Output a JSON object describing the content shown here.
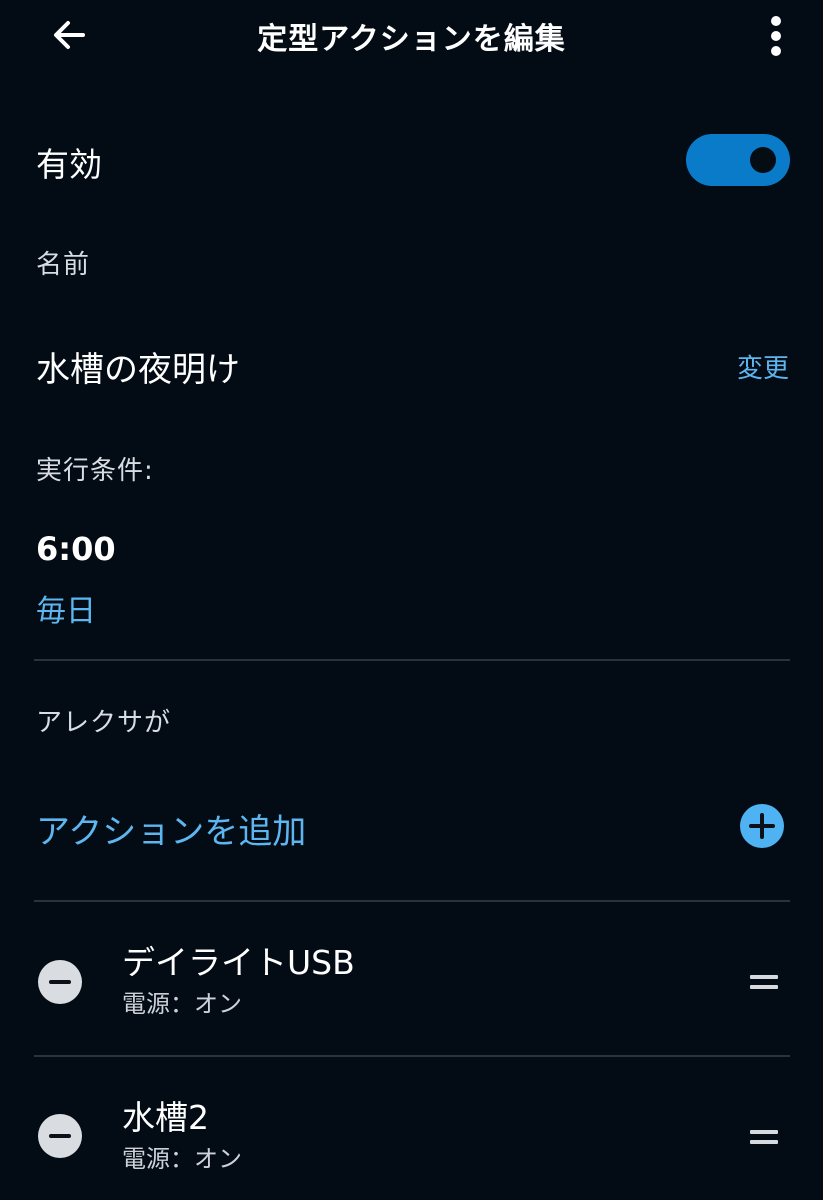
{
  "header": {
    "title": "定型アクションを編集",
    "back_icon": "arrow-left-icon",
    "more_icon": "more-vertical-icon"
  },
  "enabled": {
    "label": "有効",
    "state": "on",
    "accent_color": "#0a7bc9"
  },
  "name_section": {
    "label": "名前",
    "value": "水槽の夜明け",
    "change_label": "変更"
  },
  "trigger_section": {
    "label": "実行条件:",
    "time": "6:00",
    "repeat": "毎日"
  },
  "actions_section": {
    "label": "アレクサが",
    "add_label": "アクションを追加",
    "add_icon": "plus-circle-icon",
    "items": [
      {
        "name": "デイライトUSB",
        "detail": "電源：オン"
      },
      {
        "name": "水槽2",
        "detail": "電源：オン"
      }
    ]
  },
  "colors": {
    "background": "#030b14",
    "link": "#5db6f0",
    "accent": "#0a7bc9"
  }
}
